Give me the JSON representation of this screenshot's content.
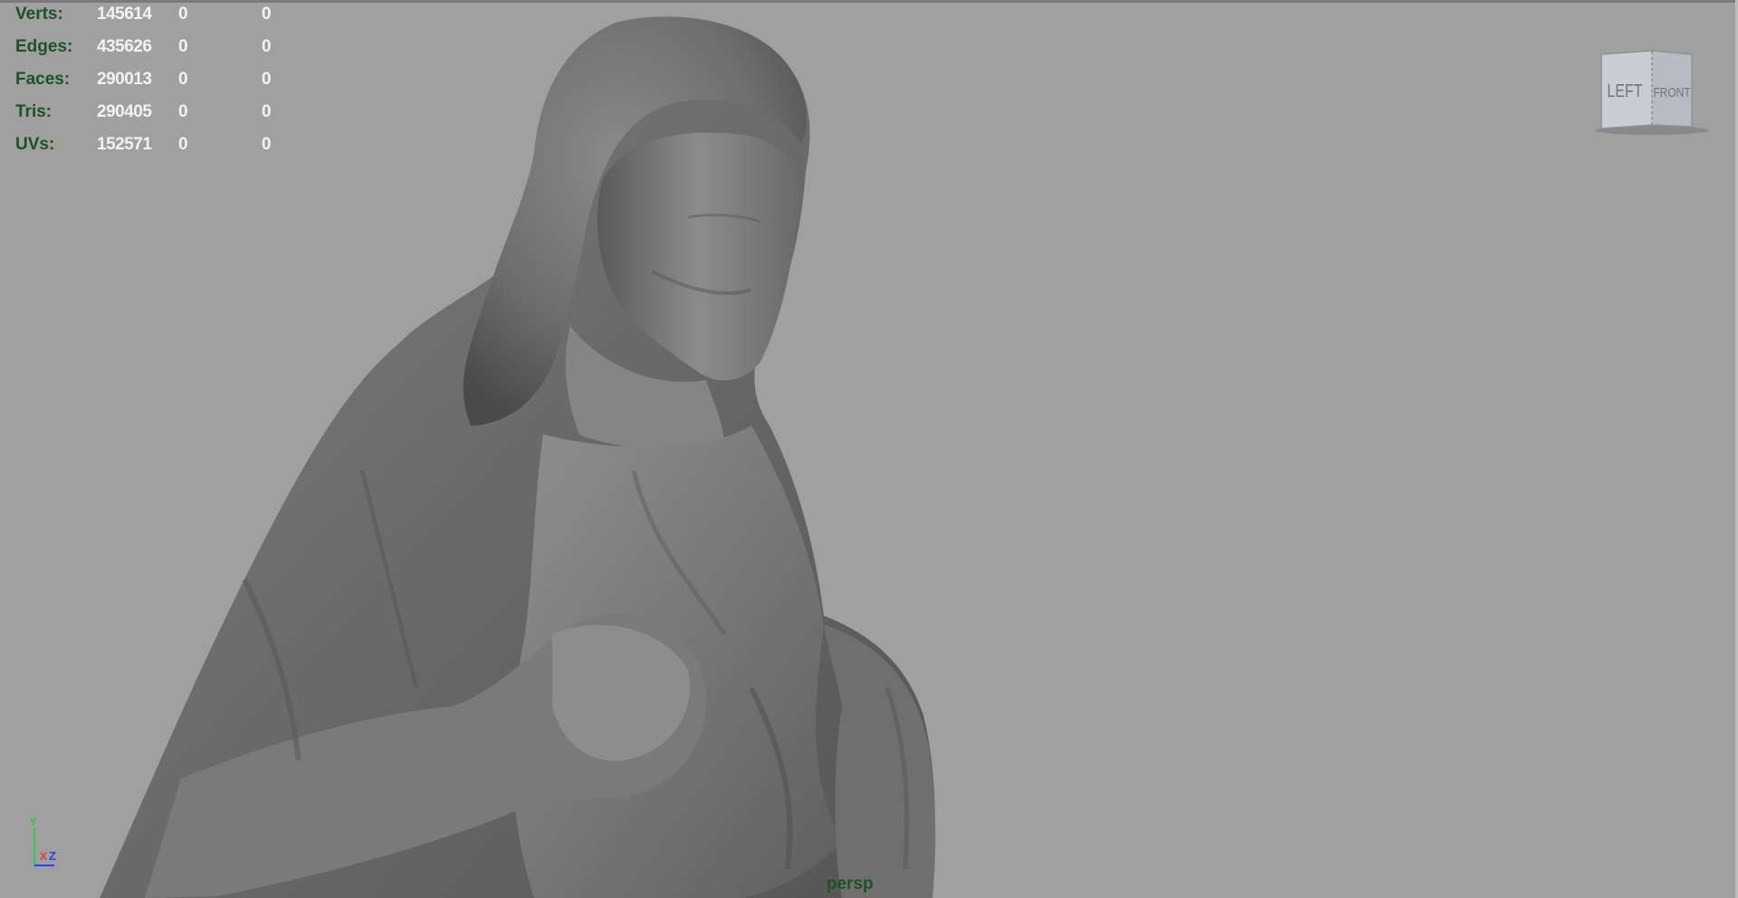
{
  "hud": {
    "rows": [
      {
        "label": "Verts:",
        "values": [
          "145614",
          "0",
          "0"
        ]
      },
      {
        "label": "Edges:",
        "values": [
          "435626",
          "0",
          "0"
        ]
      },
      {
        "label": "Faces:",
        "values": [
          "290013",
          "0",
          "0"
        ]
      },
      {
        "label": "Tris:",
        "values": [
          "290405",
          "0",
          "0"
        ]
      },
      {
        "label": "UVs:",
        "values": [
          "152571",
          "0",
          "0"
        ]
      }
    ]
  },
  "viewcube": {
    "left_face": "LEFT",
    "front_face": "FRONT"
  },
  "axis_gizmo": {
    "y": "Y",
    "x": "X",
    "z": "Z"
  },
  "camera": {
    "name": "persp"
  },
  "colors": {
    "viewport_bg": "#a0a0a0",
    "hud_label": "#1d5226",
    "hud_value": "#f2f2f2",
    "axis_y": "#2ecc40",
    "axis_x": "#e53935",
    "axis_z": "#1e40ff"
  }
}
